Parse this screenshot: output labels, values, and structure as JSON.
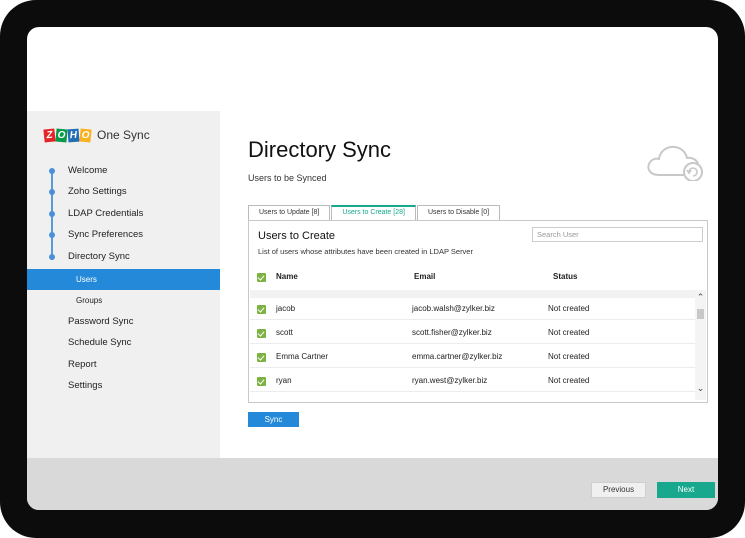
{
  "brand": {
    "logo_letters": [
      "Z",
      "O",
      "H",
      "O"
    ],
    "product_name": "One Sync"
  },
  "sidebar": {
    "items": [
      {
        "label": "Welcome"
      },
      {
        "label": "Zoho Settings"
      },
      {
        "label": "LDAP Credentials"
      },
      {
        "label": "Sync Preferences"
      },
      {
        "label": "Directory Sync"
      },
      {
        "label": "Users"
      },
      {
        "label": "Groups"
      },
      {
        "label": "Password Sync"
      },
      {
        "label": "Schedule Sync"
      },
      {
        "label": "Report"
      },
      {
        "label": "Settings"
      }
    ]
  },
  "main": {
    "title": "Directory Sync",
    "subtitle": "Users to be Synced",
    "tabs": [
      {
        "label": "Users to Update [8]"
      },
      {
        "label": "Users to Create [28]"
      },
      {
        "label": "Users to Disable [0]"
      }
    ],
    "panel": {
      "title": "Users to Create",
      "description": "List of users whose attributes have been created in LDAP Server",
      "search_placeholder": "Search User",
      "columns": {
        "name": "Name",
        "email": "Email",
        "status": "Status"
      },
      "rows": [
        {
          "name": "jacob",
          "email": "jacob.walsh@zylker.biz",
          "status": "Not created"
        },
        {
          "name": "scott",
          "email": "scott.fisher@zylker.biz",
          "status": "Not created"
        },
        {
          "name": "Emma Cartner",
          "email": "emma.cartner@zylker.biz",
          "status": "Not created"
        },
        {
          "name": "ryan",
          "email": "ryan.west@zylker.biz",
          "status": "Not created"
        }
      ]
    },
    "sync_label": "Sync"
  },
  "footer": {
    "previous_label": "Previous",
    "next_label": "Next"
  },
  "colors": {
    "accent": "#2389d8",
    "green": "#18a88e",
    "check": "#7cb342"
  }
}
